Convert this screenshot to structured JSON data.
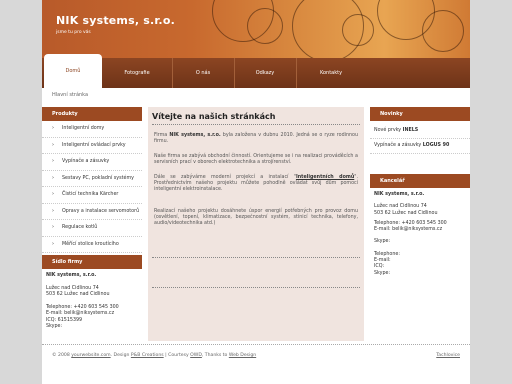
{
  "header": {
    "logo": "NIK systems, s.r.o.",
    "slogan": "jsme tu pro vás"
  },
  "nav": [
    {
      "label": "Domů"
    },
    {
      "label": "Fotografie"
    },
    {
      "label": "O nás"
    },
    {
      "label": "Odkazy"
    },
    {
      "label": "Kontakty"
    }
  ],
  "breadcrumb": "Hlavní stránka",
  "left": {
    "products_title": "Produkty",
    "items": [
      "Inteligentní domy",
      "Inteligentní ovládací prvky",
      "Vypínače a zásuvky",
      "Sestavy PC, pokladní systémy",
      "Čisticí technika Kärcher",
      "Opravy a instalace servomotorů",
      "Regulace kotlů",
      "Měřící stolice kroutícího"
    ],
    "office_title": "Sídlo firmy",
    "company": "NIK systems, s.r.o.",
    "address1": "Lužec nad Cidlinou 74",
    "address2": "503 62 Lužec nad Cidlinou",
    "phone": "Telephone: +420 603 545 300",
    "email": "E-mail: belik@niksystems.cz",
    "icq": "ICQ: 61515399",
    "skype": "Skype:"
  },
  "center": {
    "title": "Vítejte na našich stránkách",
    "p1_a": "Firma ",
    "p1_b": "NIK systems, s.r.o.",
    "p1_c": " byla založena v dubnu 2010. Jedná se o ryze rodinnou firmu.",
    "p2": "Naše firma se zabývá obchodní činností. Orientujeme se i na realizaci prováděcích a servisních prací v oborech elektrotechnika a strojírenství.",
    "p3_a": "Dále se zabýváme moderní projekcí a instalací \"",
    "p3_link": "Inteligentních domů",
    "p3_c": "\". Prostřednictvím našeho projektu můžete pohodlně ovládat svůj dům pomocí inteligentní elektroinstalace.",
    "p4": "Realizací našeho projektu dosáhnete úspor energií potřebných pro provoz domu (osvětlení, topení, klimatizace, bezpečnostní systém, stínicí technika, telefony, audio/videotechnika atd.)"
  },
  "right": {
    "news_title": "Novinky",
    "news": [
      {
        "a": "Nové prvky ",
        "b": "INELS"
      },
      {
        "a": "Vypínače a zásuvky ",
        "b": "LOGUS 90"
      }
    ],
    "office_title": "Kancelář",
    "company": "NIK systems, s.r.o.",
    "address1": "Lužec nad Cidlinou 74",
    "address2": "503 62 Lužec nad Cidlinou",
    "phone": "Telephone: +420 603 545 300",
    "email": "E-mail: belik@niksystems.cz",
    "skype1": "Skype:",
    "phone2": "Telephone:",
    "email2": "E-mail:",
    "icq2": "ICQ:",
    "skype2": "Skype:"
  },
  "footer": {
    "copyright": "© 2008 ",
    "site": "yourwebsite.com",
    "design_a": ". Design ",
    "design_b": "P&B Creations",
    "courtesy_a": " | Courtesy ",
    "courtesy_b": "OWD",
    "thanks_a": ", Thanks to ",
    "thanks_b": "Web Design",
    "right": "Tachlovice"
  }
}
